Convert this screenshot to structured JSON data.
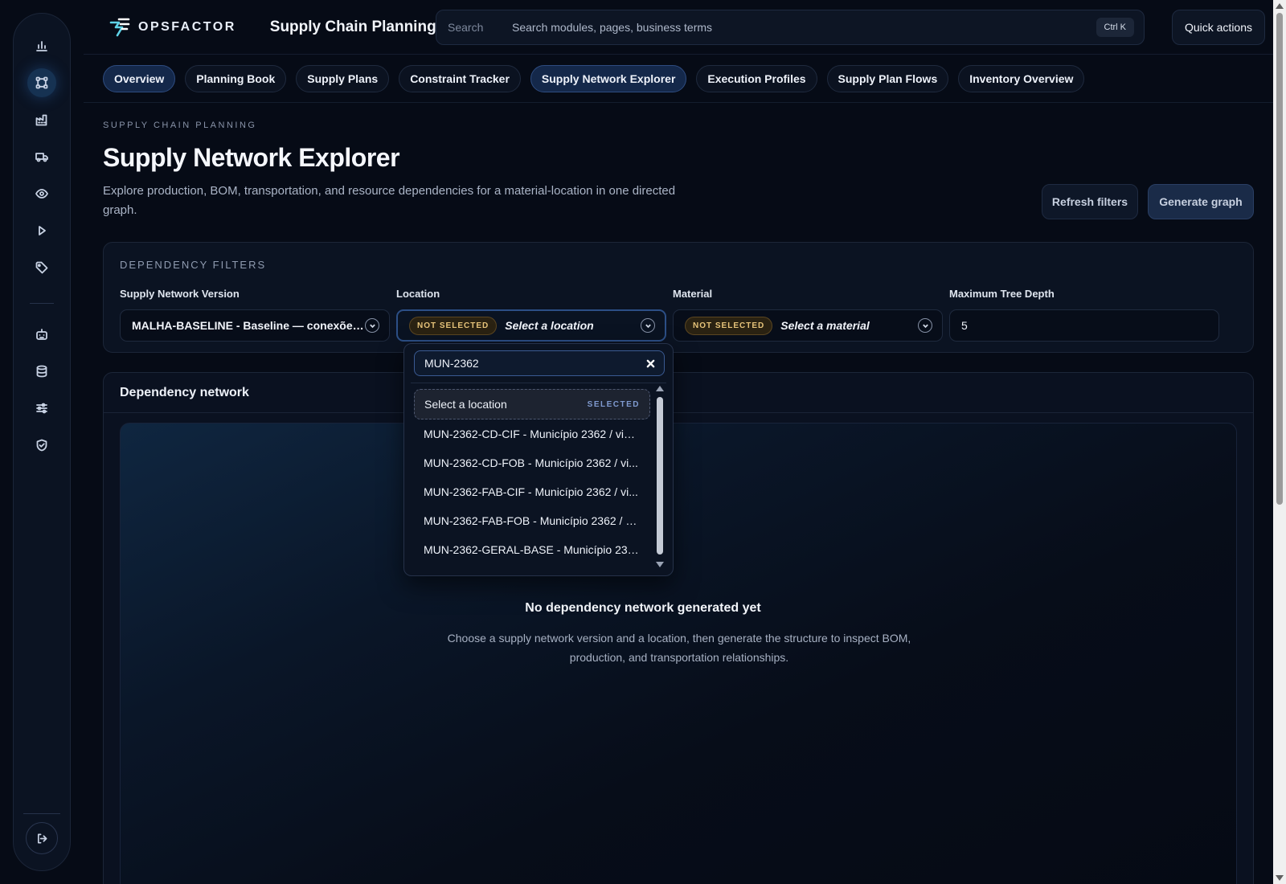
{
  "brand": {
    "name": "OPSFACTOR",
    "app_title": "Supply Chain Planning"
  },
  "colors": {
    "accent": "#2c4f86",
    "badge_warning": "#e6c37a",
    "background": "#060b16"
  },
  "search": {
    "label": "Search",
    "placeholder": "Search modules, pages, business terms",
    "shortcut": "Ctrl K"
  },
  "header": {
    "quick_actions": "Quick actions"
  },
  "sidebar": {
    "items": [
      {
        "icon": "bar-chart-icon"
      },
      {
        "icon": "network-icon",
        "active": true
      },
      {
        "icon": "factory-icon"
      },
      {
        "icon": "truck-icon"
      },
      {
        "icon": "eye-icon"
      },
      {
        "icon": "play-icon"
      },
      {
        "icon": "tag-icon"
      },
      {
        "icon": "robot-icon"
      },
      {
        "icon": "database-icon"
      },
      {
        "icon": "sliders-icon"
      },
      {
        "icon": "shield-check-icon"
      }
    ],
    "logout_icon": "logout-icon"
  },
  "tabs": [
    {
      "label": "Overview",
      "active": true
    },
    {
      "label": "Planning Book"
    },
    {
      "label": "Supply Plans"
    },
    {
      "label": "Constraint Tracker"
    },
    {
      "label": "Supply Network Explorer",
      "active": true
    },
    {
      "label": "Execution Profiles"
    },
    {
      "label": "Supply Plan Flows"
    },
    {
      "label": "Inventory Overview"
    }
  ],
  "page": {
    "eyebrow": "SUPPLY CHAIN PLANNING",
    "title": "Supply Network Explorer",
    "description": "Explore production, BOM, transportation, and resource dependencies for a material-location in one directed graph.",
    "refresh_label": "Refresh filters",
    "generate_label": "Generate graph"
  },
  "filters": {
    "title": "DEPENDENCY FILTERS",
    "version": {
      "label": "Supply Network Version",
      "value": "MALHA-BASELINE - Baseline — conexões..."
    },
    "location": {
      "label": "Location",
      "badge": "NOT SELECTED",
      "value": "Select a location"
    },
    "material": {
      "label": "Material",
      "badge": "NOT SELECTED",
      "value": "Select a material"
    },
    "depth": {
      "label": "Maximum Tree Depth",
      "value": "5"
    }
  },
  "dropdown": {
    "query": "MUN-2362",
    "selected_badge": "SELECTED",
    "options": [
      {
        "label": "Select a location",
        "selected": true
      },
      {
        "label": "MUN-2362-CD-CIF - Município 2362 / via ..."
      },
      {
        "label": "MUN-2362-CD-FOB - Município 2362 / vi..."
      },
      {
        "label": "MUN-2362-FAB-CIF - Município 2362 / vi..."
      },
      {
        "label": "MUN-2362-FAB-FOB - Município 2362 / vi..."
      },
      {
        "label": "MUN-2362-GERAL-BASE - Município 236..."
      }
    ]
  },
  "network": {
    "title": "Dependency network",
    "empty_title": "No dependency network generated yet",
    "empty_desc": "Choose a supply network version and a location, then generate the structure to inspect BOM, production, and transportation relationships."
  }
}
